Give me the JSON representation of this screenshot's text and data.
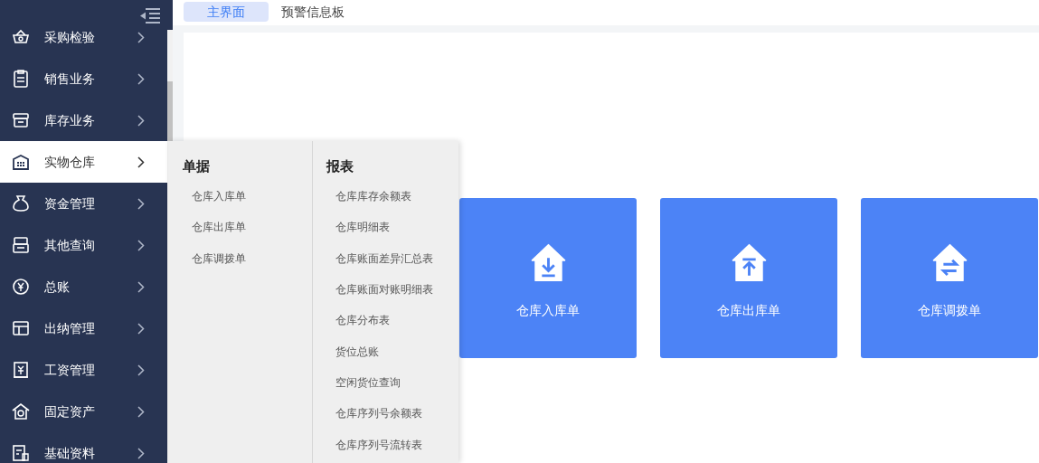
{
  "tabs": [
    {
      "label": "主界面",
      "selected": true
    },
    {
      "label": "预警信息板",
      "selected": false
    }
  ],
  "sidebar": {
    "items": [
      {
        "label": "采购检验",
        "selected": false
      },
      {
        "label": "销售业务",
        "selected": false
      },
      {
        "label": "库存业务",
        "selected": false
      },
      {
        "label": "实物仓库",
        "selected": true
      },
      {
        "label": "资金管理",
        "selected": false
      },
      {
        "label": "其他查询",
        "selected": false
      },
      {
        "label": "总账",
        "selected": false
      },
      {
        "label": "出纳管理",
        "selected": false
      },
      {
        "label": "工资管理",
        "selected": false
      },
      {
        "label": "固定资产",
        "selected": false
      },
      {
        "label": "基础资料",
        "selected": false
      }
    ]
  },
  "flyout": {
    "columns": [
      {
        "heading": "单据",
        "items": [
          "仓库入库单",
          "仓库出库单",
          "仓库调拨单"
        ]
      },
      {
        "heading": "报表",
        "items": [
          "仓库库存余额表",
          "仓库明细表",
          "仓库账面差异汇总表",
          "仓库账面对账明细表",
          "仓库分布表",
          "货位总账",
          "空闲货位查询",
          "仓库序列号余额表",
          "仓库序列号流转表"
        ]
      }
    ]
  },
  "cards": [
    {
      "label": "仓库入库单",
      "kind": "in"
    },
    {
      "label": "仓库出库单",
      "kind": "out"
    },
    {
      "label": "仓库调拨单",
      "kind": "transfer"
    }
  ]
}
